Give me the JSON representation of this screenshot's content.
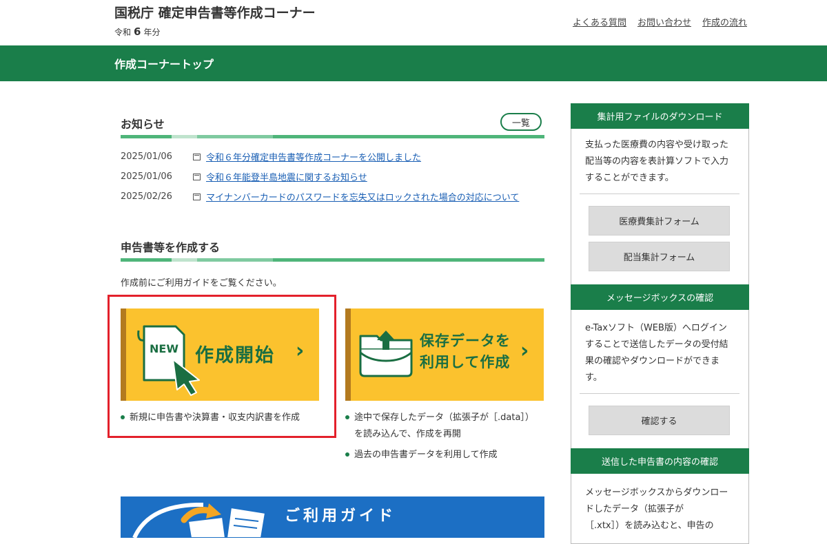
{
  "header": {
    "site_title": "国税庁 確定申告書等作成コーナー",
    "era_prefix": "令和",
    "era_year": "6",
    "era_suffix": "年分",
    "links": [
      "よくある質問",
      "お問い合わせ",
      "作成の流れ"
    ]
  },
  "banner": {
    "title": "作成コーナートップ"
  },
  "news": {
    "heading": "お知らせ",
    "list_button": "一覧",
    "items": [
      {
        "date": "2025/01/06",
        "text": "令和６年分確定申告書等作成コーナーを公開しました"
      },
      {
        "date": "2025/01/06",
        "text": "令和６年能登半島地震に関するお知らせ"
      },
      {
        "date": "2025/02/26",
        "text": "マイナンバーカードのパスワードを忘失又はロックされた場合の対応について"
      }
    ]
  },
  "create": {
    "heading": "申告書等を作成する",
    "intro": "作成前にご利用ガイドをご覧ください。",
    "new_card": {
      "badge": "NEW",
      "label": "作成開始",
      "bullets": [
        "新規に申告書や決算書・収支内訳書を作成"
      ]
    },
    "saved_card": {
      "label_line1": "保存データを",
      "label_line2": "利用して作成",
      "bullets": [
        "途中で保存したデータ（拡張子が［.data］）",
        "を読み込んで、作成を再開",
        "過去の申告書データを利用して作成"
      ]
    }
  },
  "guide_banner": {
    "text": "ご利用ガイド"
  },
  "sidebar": {
    "download": {
      "heading": "集計用ファイルのダウンロード",
      "text": [
        "支払った医療費の内容や受け取った",
        "配当等の内容を表計算ソフトで入力",
        "することができます。"
      ],
      "buttons": [
        "医療費集計フォーム",
        "配当集計フォーム"
      ]
    },
    "messagebox": {
      "heading": "メッセージボックスの確認",
      "text": [
        "e-Taxソフト（WEB版）へログイン",
        "することで送信したデータの受付結",
        "果の確認やダウンロードができま",
        "す。"
      ],
      "button": "確認する"
    },
    "sent": {
      "heading": "送信した申告書の内容の確認",
      "text": [
        "メッセージボックスからダウンロー",
        "ドしたデータ（拡張子が",
        "［.xtx］）を読み込むと、申告の"
      ]
    }
  },
  "colors": {
    "brand_green": "#1a7e4a",
    "card_yellow": "#fbc22e",
    "highlight_red": "#e3202b",
    "guide_blue": "#1c6fc4"
  }
}
